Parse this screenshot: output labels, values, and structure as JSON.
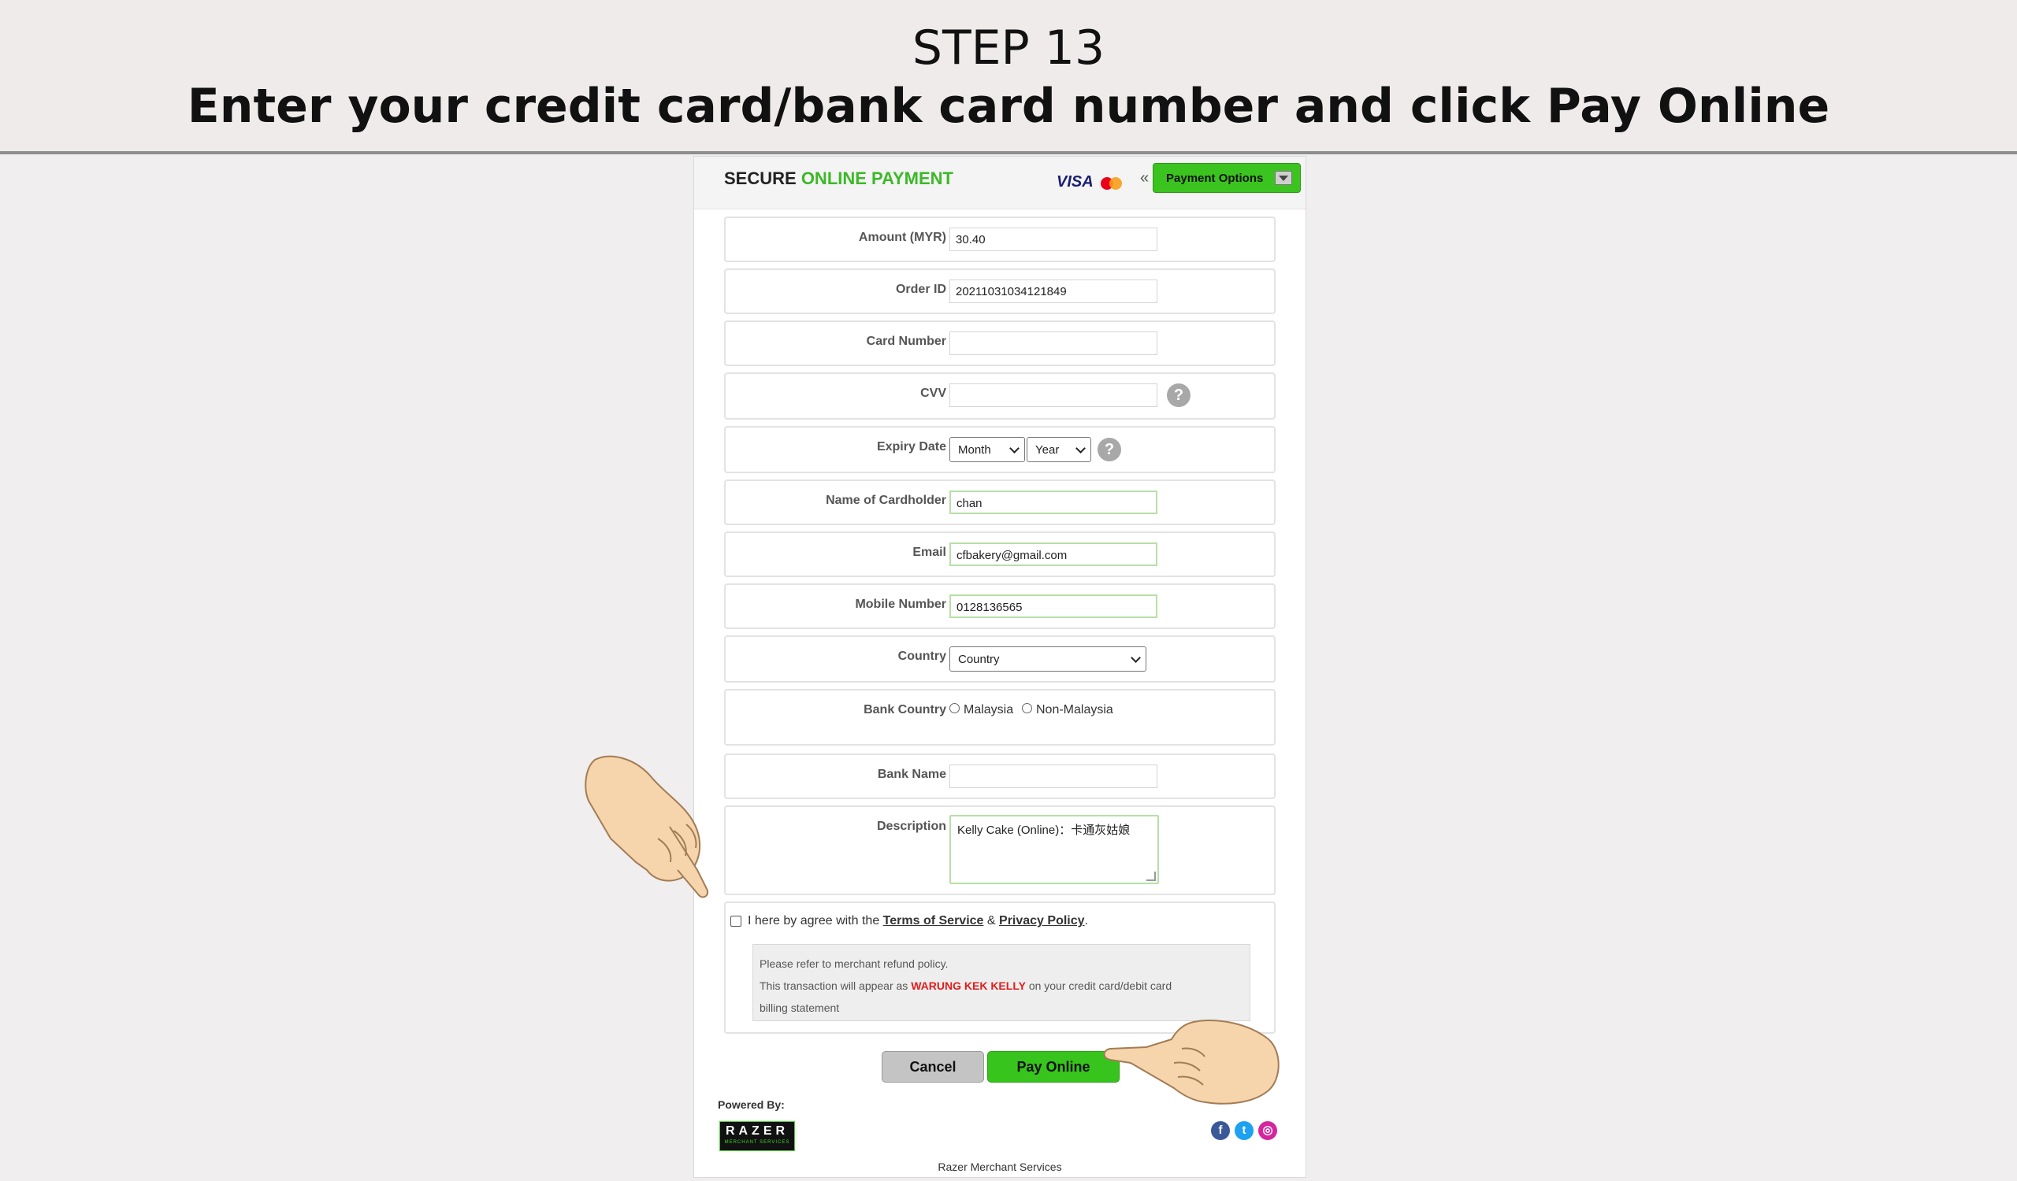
{
  "banner": {
    "step": "STEP 13",
    "instruction": "Enter your credit card/bank card number and click Pay Online"
  },
  "header": {
    "brand_secure": "SECURE",
    "brand_online": "ONLINE PAYMENT",
    "visa": "VISA",
    "prefix": "«",
    "payment_options": "Payment Options"
  },
  "form": {
    "amount_label": "Amount (MYR)",
    "amount_value": "30.40",
    "order_label": "Order ID",
    "order_value": "20211031034121849",
    "card_label": "Card Number",
    "card_value": "",
    "cvv_label": "CVV",
    "cvv_value": "",
    "help_glyph": "?",
    "expiry_label": "Expiry Date",
    "month": "Month",
    "year": "Year",
    "name_label": "Name of Cardholder",
    "name_value": "chan",
    "email_label": "Email",
    "email_value": "cfbakery@gmail.com",
    "mobile_label": "Mobile Number",
    "mobile_value": "0128136565",
    "country_label": "Country",
    "country_value": "Country",
    "bank_country_label": "Bank Country",
    "bank_country_options": [
      "Malaysia",
      "Non-Malaysia"
    ],
    "bank_name_label": "Bank Name",
    "bank_name_value": "",
    "description_label": "Description",
    "description_value": "Kelly Cake (Online)：卡通灰姑娘"
  },
  "agree": {
    "prefix": "I here by agree with the",
    "terms": "Terms of Service",
    "amp": "&",
    "privacy": "Privacy Policy",
    "suffix": ".",
    "note_line1": "Please refer to merchant refund policy.",
    "note_line2_pre": "This transaction will appear as",
    "merchant": "WARUNG KEK KELLY",
    "note_line2_post": "on your credit card/debit card",
    "note_line3": "billing statement"
  },
  "buttons": {
    "cancel": "Cancel",
    "pay": "Pay Online"
  },
  "footer": {
    "powered_by": "Powered By:",
    "razer_logo": "RAZER",
    "razer_sub": "MERCHANT SERVICES",
    "company": "Razer Merchant Services",
    "social": [
      {
        "icon": "facebook-icon",
        "glyph": "f",
        "color": "#3b5998"
      },
      {
        "icon": "twitter-icon",
        "glyph": "t",
        "color": "#1da1f2"
      },
      {
        "icon": "instagram-icon",
        "glyph": "◎",
        "color": "#d6249f"
      }
    ]
  },
  "colors": {
    "accent_green": "#3cb829",
    "merchant_red": "#e01d1d"
  }
}
